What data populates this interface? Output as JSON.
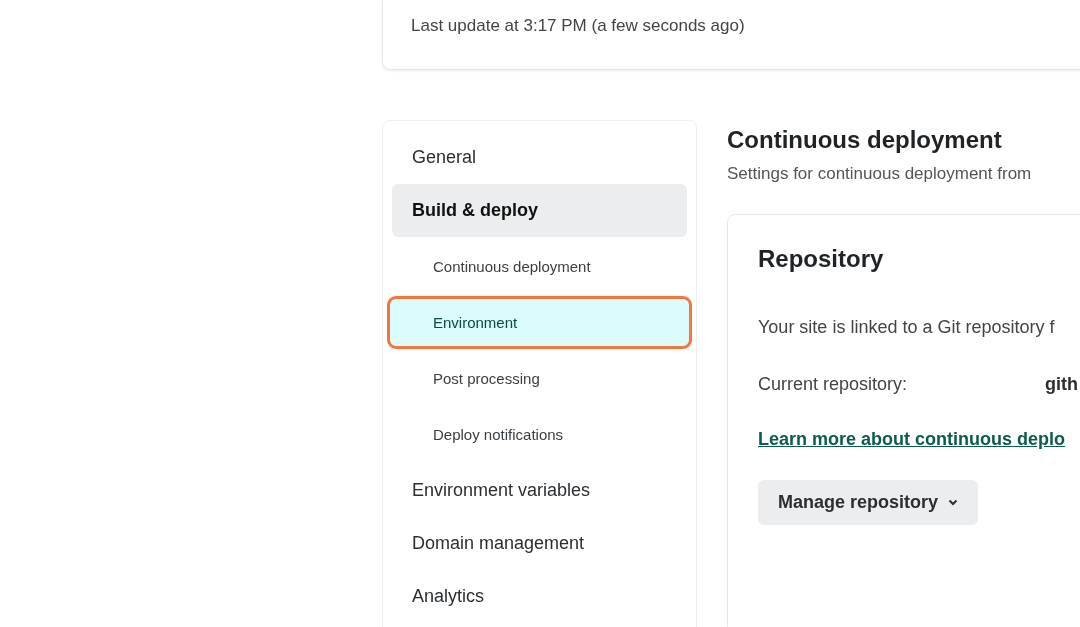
{
  "update_card": {
    "text": "Last update at 3:17 PM (a few seconds ago)"
  },
  "sidebar": {
    "items": [
      {
        "label": "General",
        "selected": false
      },
      {
        "label": "Build & deploy",
        "selected": true,
        "expanded": true,
        "children": [
          {
            "label": "Continuous deployment",
            "selected": false,
            "highlighted": false
          },
          {
            "label": "Environment",
            "selected": true,
            "highlighted": true
          },
          {
            "label": "Post processing",
            "selected": false,
            "highlighted": false
          },
          {
            "label": "Deploy notifications",
            "selected": false,
            "highlighted": false
          }
        ]
      },
      {
        "label": "Environment variables",
        "selected": false
      },
      {
        "label": "Domain management",
        "selected": false
      },
      {
        "label": "Analytics",
        "selected": false
      }
    ]
  },
  "section": {
    "title": "Continuous deployment",
    "subtitle": "Settings for continuous deployment from"
  },
  "repository_card": {
    "title": "Repository",
    "description": "Your site is linked to a Git repository f",
    "current_label": "Current repository:",
    "current_value": "gith",
    "link": "Learn more about continuous deplo",
    "button": "Manage repository"
  }
}
